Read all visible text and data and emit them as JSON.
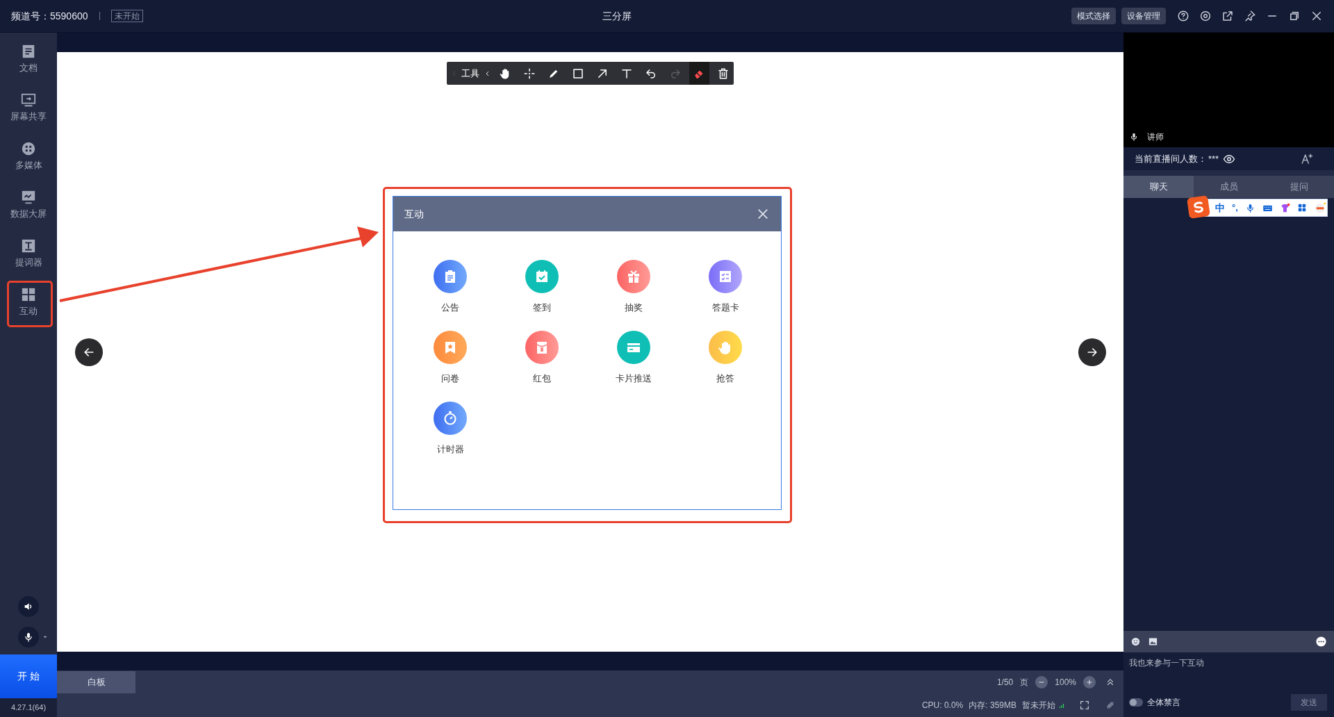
{
  "top_bar": {
    "channel": "频道号：5590600",
    "status_badge": "未开始",
    "title": "三分屏",
    "buttons": [
      "模式选择",
      "设备管理"
    ]
  },
  "sidebar": {
    "items": [
      {
        "label": "文档",
        "kind": "doc"
      },
      {
        "label": "屏幕共享",
        "kind": "screen"
      },
      {
        "label": "多媒体",
        "kind": "media"
      },
      {
        "label": "数据大屏",
        "kind": "data"
      },
      {
        "label": "提词器",
        "kind": "prompter"
      },
      {
        "label": "互动",
        "kind": "interact"
      }
    ],
    "start_button": "开 始",
    "version": "4.27.1(64)"
  },
  "toolbar": {
    "label": "工具",
    "tools": [
      {
        "kind": "hand",
        "selected": false,
        "disabled": false
      },
      {
        "kind": "move",
        "selected": false,
        "disabled": false
      },
      {
        "kind": "pen",
        "selected": false,
        "disabled": false
      },
      {
        "kind": "rect",
        "selected": false,
        "disabled": false
      },
      {
        "kind": "arrow",
        "selected": false,
        "disabled": false
      },
      {
        "kind": "text",
        "selected": false,
        "disabled": false
      },
      {
        "kind": "undo",
        "selected": false,
        "disabled": false
      },
      {
        "kind": "redo",
        "selected": false,
        "disabled": true
      },
      {
        "kind": "eraser",
        "selected": true,
        "disabled": false
      },
      {
        "kind": "delete",
        "selected": false,
        "disabled": false
      }
    ]
  },
  "dialog": {
    "title": "互动",
    "items": [
      {
        "label": "公告",
        "kind": "notice"
      },
      {
        "label": "签到",
        "kind": "checkin"
      },
      {
        "label": "抽奖",
        "kind": "lottery"
      },
      {
        "label": "答题卡",
        "kind": "quiz"
      },
      {
        "label": "问卷",
        "kind": "survey"
      },
      {
        "label": "红包",
        "kind": "redpacket"
      },
      {
        "label": "卡片推送",
        "kind": "card"
      },
      {
        "label": "抢答",
        "kind": "buzz"
      },
      {
        "label": "计时器",
        "kind": "timer"
      }
    ]
  },
  "right_panel": {
    "video_label": "讲师",
    "viewers_label": "当前直播间人数：",
    "viewers_count": "***",
    "tabs": [
      {
        "label": "聊天",
        "selected": true
      },
      {
        "label": "成员",
        "selected": false
      },
      {
        "label": "提问",
        "selected": false
      }
    ],
    "ime_bar": {
      "mode": "中",
      "punctuation": "°,"
    },
    "chat_input": {
      "placeholder": "我也来参与一下互动"
    },
    "mute_all": {
      "label": "全体禁言",
      "on": false
    },
    "send_button": "发送"
  },
  "bottom_bar": {
    "tabs": [
      {
        "label": "白板",
        "selected": true
      }
    ],
    "page": "1/50",
    "page_unit": "页",
    "zoom": "100%",
    "cpu": "CPU: 0.0%",
    "memory": "内存: 359MB",
    "stream_status": "暂未开始"
  }
}
